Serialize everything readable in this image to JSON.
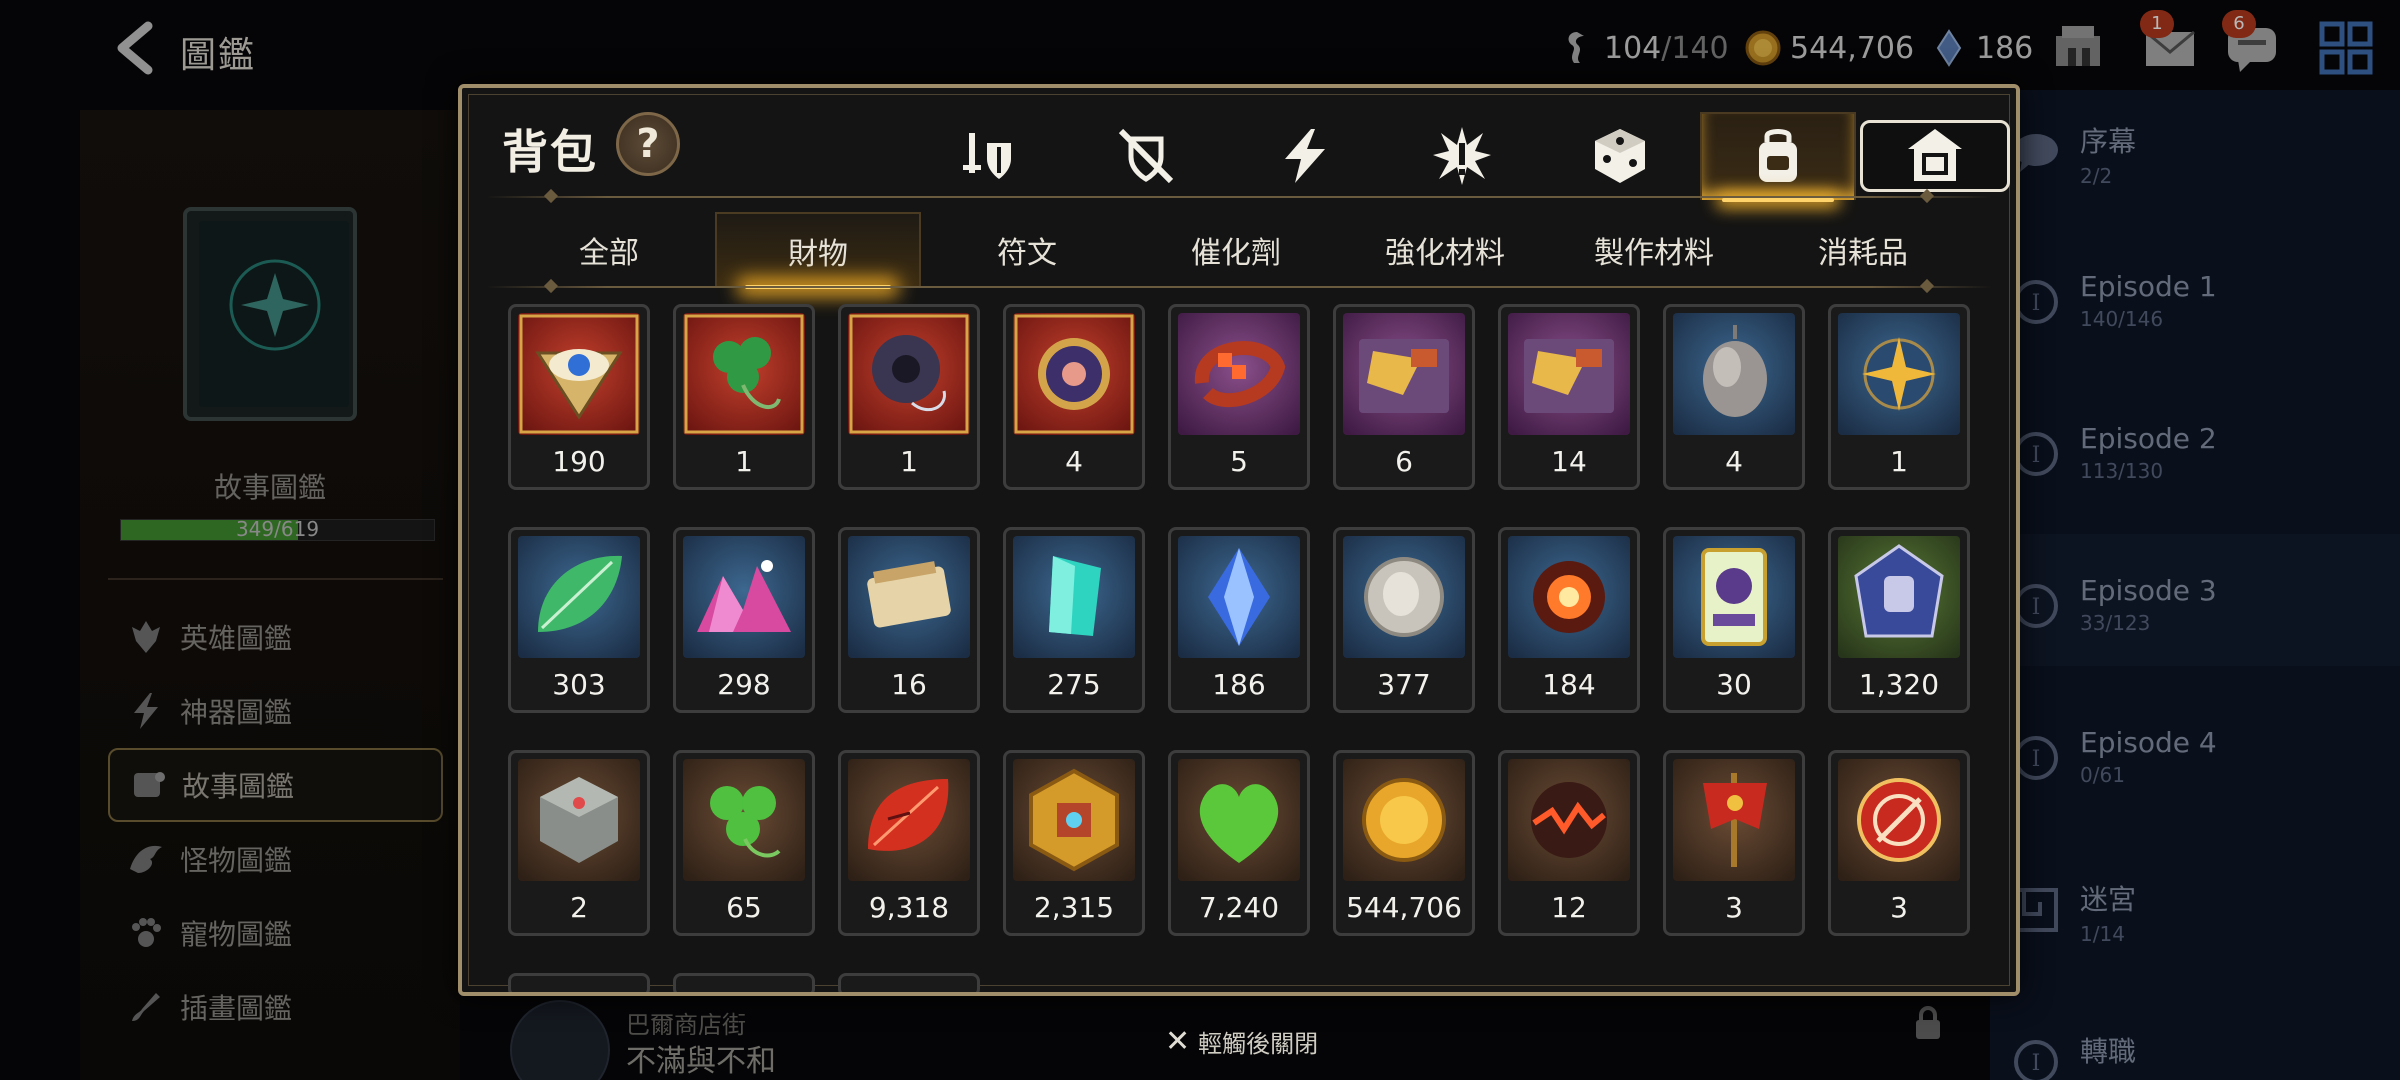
{
  "topbar": {
    "title": "圖鑑",
    "stamina": "104",
    "stamina_max": "/140",
    "gold": "544,706",
    "crystals": "186",
    "mail_badge": "1",
    "chat_badge": "6"
  },
  "left_panel": {
    "caption": "故事圖鑑",
    "progress_text": "349/619",
    "progress_fraction": 0.564,
    "nav": [
      {
        "label": "英雄圖鑑",
        "icon": "hero-icon"
      },
      {
        "label": "神器圖鑑",
        "icon": "lightning-icon"
      },
      {
        "label": "故事圖鑑",
        "icon": "scroll-icon",
        "active": true
      },
      {
        "label": "怪物圖鑑",
        "icon": "dragon-icon"
      },
      {
        "label": "寵物圖鑑",
        "icon": "paw-icon"
      },
      {
        "label": "插畫圖鑑",
        "icon": "brush-icon"
      }
    ]
  },
  "right_panel": {
    "rows": [
      {
        "title": "序幕",
        "sub": "2/2",
        "icon": "speech-bubble-icon"
      },
      {
        "title": "Episode 1",
        "sub": "140/146",
        "icon": "episode-emblem-icon"
      },
      {
        "title": "Episode 2",
        "sub": "113/130",
        "icon": "episode-emblem-icon"
      },
      {
        "title": "Episode 3",
        "sub": "33/123",
        "icon": "episode-emblem-icon"
      },
      {
        "title": "Episode 4",
        "sub": "0/61",
        "icon": "episode-emblem-icon"
      },
      {
        "title": "迷宮",
        "sub": "1/14",
        "icon": "maze-icon"
      },
      {
        "title": "轉職",
        "sub": "",
        "icon": "class-change-icon"
      }
    ]
  },
  "bottom_story": {
    "subtitle": "巴爾商店街",
    "title": "不滿與不和"
  },
  "close_hint": "輕觸後關閉",
  "modal": {
    "title": "背包",
    "help": "?",
    "category_tabs": [
      {
        "icon": "weapon-armor-icon"
      },
      {
        "icon": "no-equipment-icon"
      },
      {
        "icon": "lightning-icon"
      },
      {
        "icon": "explosion-icon"
      },
      {
        "icon": "dice-icon"
      },
      {
        "icon": "backpack-icon",
        "active": true
      },
      {
        "icon": "house-icon",
        "boxed": true
      }
    ],
    "sub_tabs": [
      {
        "label": "全部"
      },
      {
        "label": "財物",
        "active": true
      },
      {
        "label": "符文"
      },
      {
        "label": "催化劑"
      },
      {
        "label": "強化材料"
      },
      {
        "label": "製作材料"
      },
      {
        "label": "消耗品"
      }
    ],
    "items": [
      {
        "qty": "190",
        "bg": "red",
        "icon": "eye-emblem-icon"
      },
      {
        "qty": "1",
        "bg": "red",
        "icon": "clover-charm-icon"
      },
      {
        "qty": "1",
        "bg": "red",
        "icon": "dark-ring-icon"
      },
      {
        "qty": "4",
        "bg": "red",
        "icon": "violet-disc-icon"
      },
      {
        "qty": "5",
        "bg": "purple",
        "icon": "flower-ring-icon"
      },
      {
        "qty": "6",
        "bg": "purple",
        "icon": "gift-box-icon"
      },
      {
        "qty": "14",
        "bg": "purple",
        "icon": "gift-box-icon"
      },
      {
        "qty": "4",
        "bg": "blue",
        "icon": "gray-stone-icon"
      },
      {
        "qty": "1",
        "bg": "blue",
        "icon": "star-compass-icon"
      },
      {
        "qty": "303",
        "bg": "blue",
        "icon": "leaf-icon"
      },
      {
        "qty": "298",
        "bg": "blue",
        "icon": "pink-crystal-pile-icon"
      },
      {
        "qty": "16",
        "bg": "blue",
        "icon": "scroll-bundle-icon"
      },
      {
        "qty": "275",
        "bg": "blue",
        "icon": "teal-crystal-icon"
      },
      {
        "qty": "186",
        "bg": "blue",
        "icon": "blue-gem-icon"
      },
      {
        "qty": "377",
        "bg": "blue",
        "icon": "silver-coin-icon"
      },
      {
        "qty": "184",
        "bg": "blue",
        "icon": "fire-orb-icon"
      },
      {
        "qty": "30",
        "bg": "blue",
        "icon": "card-icon"
      },
      {
        "qty": "1,320",
        "bg": "green",
        "icon": "fist-emblem-icon"
      },
      {
        "qty": "2",
        "bg": "brown",
        "icon": "stone-cube-icon"
      },
      {
        "qty": "65",
        "bg": "brown",
        "icon": "clover-icon"
      },
      {
        "qty": "9,318",
        "bg": "brown",
        "icon": "red-leaf-icon"
      },
      {
        "qty": "2,315",
        "bg": "brown",
        "icon": "gold-hex-emblem-icon"
      },
      {
        "qty": "7,240",
        "bg": "brown",
        "icon": "green-heart-icon"
      },
      {
        "qty": "544,706",
        "bg": "brown",
        "icon": "gold-coin-icon"
      },
      {
        "qty": "12",
        "bg": "brown",
        "icon": "lava-orb-icon"
      },
      {
        "qty": "3",
        "bg": "brown",
        "icon": "banner-icon"
      },
      {
        "qty": "3",
        "bg": "brown",
        "icon": "red-seal-icon"
      }
    ]
  },
  "colors": {
    "gold_accent": "#ffd36a",
    "frame": "#a08d6a",
    "bg_red": "#8c1e1a",
    "bg_purple": "#5b2a5e",
    "bg_blue": "#294766",
    "bg_green": "#3d5524",
    "bg_brown": "#4a3525"
  }
}
